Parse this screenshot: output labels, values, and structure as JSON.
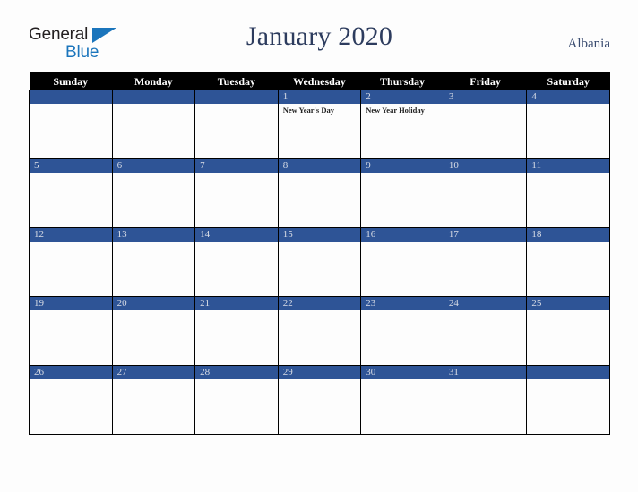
{
  "brand": {
    "word_one": "General",
    "word_two": "Blue",
    "triangle_icon": "blue-triangle-icon",
    "color_dark": "#231f20",
    "color_blue": "#1b75bc"
  },
  "header": {
    "title": "January 2020",
    "country": "Albania",
    "title_color": "#2d3c5e"
  },
  "calendar": {
    "weekday_headers": [
      "Sunday",
      "Monday",
      "Tuesday",
      "Wednesday",
      "Thursday",
      "Friday",
      "Saturday"
    ],
    "header_bg": "#000000",
    "daybar_bg": "#2e5496",
    "daynum_color": "#d9dde6",
    "weeks": [
      [
        {
          "day": "",
          "events": []
        },
        {
          "day": "",
          "events": []
        },
        {
          "day": "",
          "events": []
        },
        {
          "day": "1",
          "events": [
            "New Year's Day"
          ]
        },
        {
          "day": "2",
          "events": [
            "New Year Holiday"
          ]
        },
        {
          "day": "3",
          "events": []
        },
        {
          "day": "4",
          "events": []
        }
      ],
      [
        {
          "day": "5",
          "events": []
        },
        {
          "day": "6",
          "events": []
        },
        {
          "day": "7",
          "events": []
        },
        {
          "day": "8",
          "events": []
        },
        {
          "day": "9",
          "events": []
        },
        {
          "day": "10",
          "events": []
        },
        {
          "day": "11",
          "events": []
        }
      ],
      [
        {
          "day": "12",
          "events": []
        },
        {
          "day": "13",
          "events": []
        },
        {
          "day": "14",
          "events": []
        },
        {
          "day": "15",
          "events": []
        },
        {
          "day": "16",
          "events": []
        },
        {
          "day": "17",
          "events": []
        },
        {
          "day": "18",
          "events": []
        }
      ],
      [
        {
          "day": "19",
          "events": []
        },
        {
          "day": "20",
          "events": []
        },
        {
          "day": "21",
          "events": []
        },
        {
          "day": "22",
          "events": []
        },
        {
          "day": "23",
          "events": []
        },
        {
          "day": "24",
          "events": []
        },
        {
          "day": "25",
          "events": []
        }
      ],
      [
        {
          "day": "26",
          "events": []
        },
        {
          "day": "27",
          "events": []
        },
        {
          "day": "28",
          "events": []
        },
        {
          "day": "29",
          "events": []
        },
        {
          "day": "30",
          "events": []
        },
        {
          "day": "31",
          "events": []
        },
        {
          "day": "",
          "events": []
        }
      ]
    ]
  }
}
